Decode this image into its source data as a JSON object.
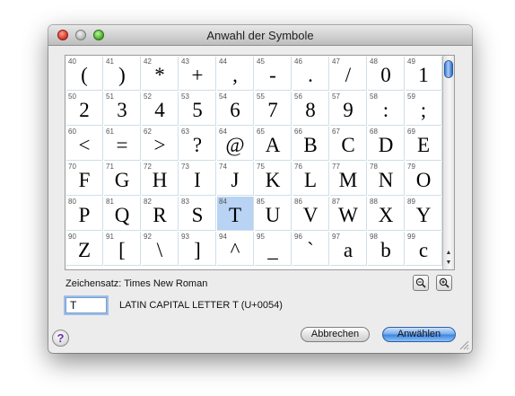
{
  "window": {
    "title": "Anwahl der Symbole"
  },
  "grid": {
    "selected_code": "84",
    "rows": [
      [
        {
          "code": "40",
          "glyph": "("
        },
        {
          "code": "41",
          "glyph": ")"
        },
        {
          "code": "42",
          "glyph": "*"
        },
        {
          "code": "43",
          "glyph": "+"
        },
        {
          "code": "44",
          "glyph": ","
        },
        {
          "code": "45",
          "glyph": "-"
        },
        {
          "code": "46",
          "glyph": "."
        },
        {
          "code": "47",
          "glyph": "/"
        },
        {
          "code": "48",
          "glyph": "0"
        },
        {
          "code": "49",
          "glyph": "1"
        }
      ],
      [
        {
          "code": "50",
          "glyph": "2"
        },
        {
          "code": "51",
          "glyph": "3"
        },
        {
          "code": "52",
          "glyph": "4"
        },
        {
          "code": "53",
          "glyph": "5"
        },
        {
          "code": "54",
          "glyph": "6"
        },
        {
          "code": "55",
          "glyph": "7"
        },
        {
          "code": "56",
          "glyph": "8"
        },
        {
          "code": "57",
          "glyph": "9"
        },
        {
          "code": "58",
          "glyph": ":"
        },
        {
          "code": "59",
          "glyph": ";"
        }
      ],
      [
        {
          "code": "60",
          "glyph": "<"
        },
        {
          "code": "61",
          "glyph": "="
        },
        {
          "code": "62",
          "glyph": ">"
        },
        {
          "code": "63",
          "glyph": "?"
        },
        {
          "code": "64",
          "glyph": "@"
        },
        {
          "code": "65",
          "glyph": "A"
        },
        {
          "code": "66",
          "glyph": "B"
        },
        {
          "code": "67",
          "glyph": "C"
        },
        {
          "code": "68",
          "glyph": "D"
        },
        {
          "code": "69",
          "glyph": "E"
        }
      ],
      [
        {
          "code": "70",
          "glyph": "F"
        },
        {
          "code": "71",
          "glyph": "G"
        },
        {
          "code": "72",
          "glyph": "H"
        },
        {
          "code": "73",
          "glyph": "I"
        },
        {
          "code": "74",
          "glyph": "J"
        },
        {
          "code": "75",
          "glyph": "K"
        },
        {
          "code": "76",
          "glyph": "L"
        },
        {
          "code": "77",
          "glyph": "M"
        },
        {
          "code": "78",
          "glyph": "N"
        },
        {
          "code": "79",
          "glyph": "O"
        }
      ],
      [
        {
          "code": "80",
          "glyph": "P"
        },
        {
          "code": "81",
          "glyph": "Q"
        },
        {
          "code": "82",
          "glyph": "R"
        },
        {
          "code": "83",
          "glyph": "S"
        },
        {
          "code": "84",
          "glyph": "T"
        },
        {
          "code": "85",
          "glyph": "U"
        },
        {
          "code": "86",
          "glyph": "V"
        },
        {
          "code": "87",
          "glyph": "W"
        },
        {
          "code": "88",
          "glyph": "X"
        },
        {
          "code": "89",
          "glyph": "Y"
        }
      ],
      [
        {
          "code": "90",
          "glyph": "Z"
        },
        {
          "code": "91",
          "glyph": "["
        },
        {
          "code": "92",
          "glyph": "\\"
        },
        {
          "code": "93",
          "glyph": "]"
        },
        {
          "code": "94",
          "glyph": "^"
        },
        {
          "code": "95",
          "glyph": "_"
        },
        {
          "code": "96",
          "glyph": "`"
        },
        {
          "code": "97",
          "glyph": "a"
        },
        {
          "code": "98",
          "glyph": "b"
        },
        {
          "code": "99",
          "glyph": "c"
        }
      ]
    ]
  },
  "scrollbar": {
    "up_arrow": "▲",
    "down_arrow": "▼"
  },
  "charset": {
    "label": "Zeichensatz: Times New Roman"
  },
  "zoom": {
    "out_icon": "zoom-out-icon",
    "in_icon": "zoom-in-icon"
  },
  "selection": {
    "input_value": "T",
    "unicode_name": "LATIN CAPITAL LETTER T (U+0054)"
  },
  "help": {
    "label": "?"
  },
  "buttons": {
    "cancel": "Abbrechen",
    "ok": "Anwählen"
  },
  "colors": {
    "selected_cell": "#b9d3f4",
    "grid_line": "#cfdfe6",
    "default_button": "#3a83e0"
  }
}
